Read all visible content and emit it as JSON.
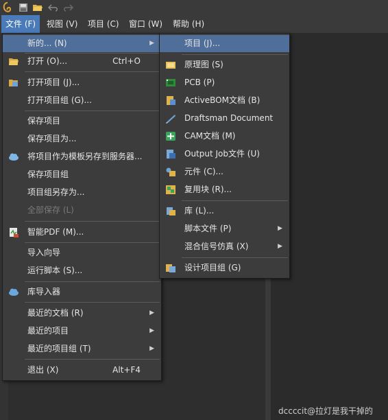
{
  "menubar": {
    "items": [
      "文件 (F)",
      "视图 (V)",
      "项目 (C)",
      "窗口 (W)",
      "帮助 (H)"
    ]
  },
  "file_menu": {
    "new": "新的... (N)",
    "open": "打开 (O)...",
    "open_shortcut": "Ctrl+O",
    "open_project": "打开项目 (J)...",
    "open_project_group": "打开项目组 (G)...",
    "save_project": "保存项目",
    "save_project_as": "保存项目为...",
    "save_as_template": "将项目作为模板另存到服务器...",
    "save_project_group": "保存项目组",
    "save_project_group_as": "项目组另存为...",
    "save_all": "全部保存 (L)",
    "smart_pdf": "智能PDF (M)...",
    "import_wizard": "导入向导",
    "run_script": "运行脚本 (S)...",
    "library_importer": "库导入器",
    "recent_documents": "最近的文档 (R)",
    "recent_projects": "最近的项目",
    "recent_project_groups": "最近的项目组 (T)",
    "exit": "退出 (X)",
    "exit_shortcut": "Alt+F4"
  },
  "new_submenu": {
    "project": "项目 (J)...",
    "schematic": "原理图 (S)",
    "pcb": "PCB (P)",
    "activebom": "ActiveBOM文档 (B)",
    "draftsman": "Draftsman Document",
    "cam": "CAM文档 (M)",
    "output_job": "Output Job文件 (U)",
    "component": "元件 (C)...",
    "reuse_block": "复用块 (R)...",
    "library": "库 (L)...",
    "script_file": "脚本文件 (P)",
    "mixed_sim": "混合信号仿真 (X)",
    "design_project_group": "设计项目组 (G)"
  },
  "watermark": "dccccit@拉灯是我干掉的",
  "colors": {
    "menu_bg": "#3c3c3c",
    "highlight": "#4f6f9a",
    "menubar_active": "#4a7ab8",
    "text": "#e6e6e6",
    "disabled_text": "#7a7a7a"
  }
}
